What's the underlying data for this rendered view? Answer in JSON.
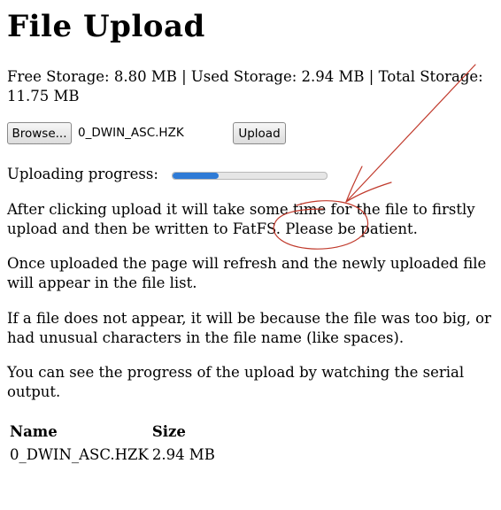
{
  "page": {
    "title": "File Upload"
  },
  "storage": {
    "text": "Free Storage: 8.80 MB | Used Storage: 2.94 MB | Total Storage: 11.75 MB"
  },
  "upload_form": {
    "browse_label": "Browse...",
    "selected_file": "0_DWIN_ASC.HZK",
    "upload_label": "Upload"
  },
  "progress": {
    "label": "Uploading progress:",
    "fraction": 0.3,
    "bar_color": "#2f7bd6"
  },
  "instructions": [
    "After clicking upload it will take some time for the file to firstly upload and then be written to FatFS. Please be patient.",
    "Once uploaded the page will refresh and the newly uploaded file will appear in the file list.",
    "If a file does not appear, it will be because the file was too big, or had unusual characters in the file name (like spaces).",
    "You can see the progress of the upload by watching the serial output."
  ],
  "file_table": {
    "headers": [
      "Name",
      "Size"
    ],
    "rows": [
      [
        "0_DWIN_ASC.HZK",
        "2.94 MB"
      ]
    ]
  },
  "annotation": {
    "color": "#c0392b"
  }
}
